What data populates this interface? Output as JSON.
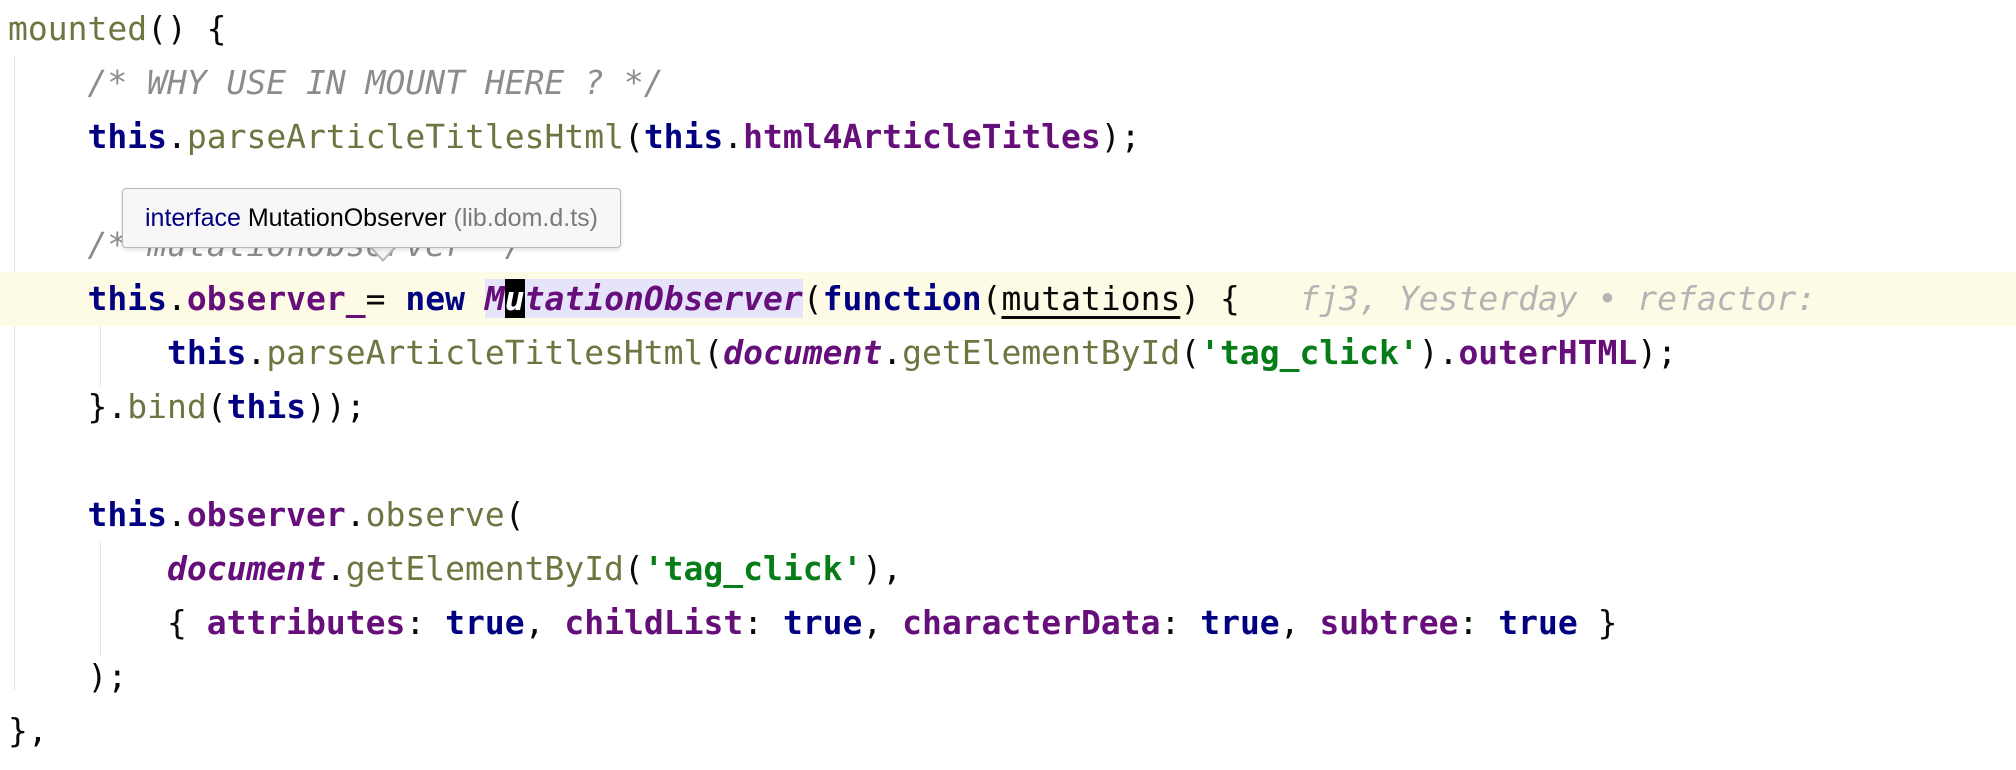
{
  "editor": {
    "lines": [
      {
        "tokens": [
          {
            "t": "mounted",
            "c": "fn"
          },
          {
            "t": "() {",
            "c": ""
          }
        ]
      },
      {
        "tokens": [
          {
            "t": "    ",
            "c": ""
          },
          {
            "t": "/* WHY USE IN MOUNT HERE ? */",
            "c": "cmt"
          }
        ]
      },
      {
        "tokens": [
          {
            "t": "    ",
            "c": ""
          },
          {
            "t": "this",
            "c": "kw"
          },
          {
            "t": ".",
            "c": ""
          },
          {
            "t": "parseArticleTitlesHtml",
            "c": "fn"
          },
          {
            "t": "(",
            "c": ""
          },
          {
            "t": "this",
            "c": "kw"
          },
          {
            "t": ".",
            "c": ""
          },
          {
            "t": "html4ArticleTitles",
            "c": "prop"
          },
          {
            "t": ");",
            "c": ""
          }
        ]
      },
      {
        "tokens": []
      },
      {
        "tokens": [
          {
            "t": "    ",
            "c": ""
          },
          {
            "t": "/* mutationObserver */",
            "c": "cmt"
          }
        ]
      },
      {
        "tokens": [
          {
            "t": "    ",
            "c": ""
          },
          {
            "t": "this",
            "c": "kw"
          },
          {
            "t": ".",
            "c": ""
          },
          {
            "t": "observer_",
            "c": "prop"
          },
          {
            "t": "= ",
            "c": ""
          },
          {
            "t": "new",
            "c": "kw"
          },
          {
            "t": " ",
            "c": ""
          },
          {
            "t": "M",
            "c": "prop ital symbol-hl"
          },
          {
            "t": "u",
            "c": "prop ital caret-char"
          },
          {
            "t": "tationObserver",
            "c": "prop ital symbol-hl"
          },
          {
            "t": "(",
            "c": ""
          },
          {
            "t": "function",
            "c": "kw"
          },
          {
            "t": "(",
            "c": ""
          },
          {
            "t": "mutations",
            "c": "param"
          },
          {
            "t": ") {   ",
            "c": ""
          },
          {
            "t": "fj3, Yesterday • refactor: ",
            "c": "blame"
          }
        ]
      },
      {
        "tokens": [
          {
            "t": "        ",
            "c": ""
          },
          {
            "t": "this",
            "c": "kw"
          },
          {
            "t": ".",
            "c": ""
          },
          {
            "t": "parseArticleTitlesHtml",
            "c": "fn"
          },
          {
            "t": "(",
            "c": ""
          },
          {
            "t": "document",
            "c": "glob"
          },
          {
            "t": ".",
            "c": ""
          },
          {
            "t": "getElementById",
            "c": "fn"
          },
          {
            "t": "(",
            "c": ""
          },
          {
            "t": "'tag_click'",
            "c": "str"
          },
          {
            "t": ").",
            "c": ""
          },
          {
            "t": "outerHTML",
            "c": "prop"
          },
          {
            "t": ");",
            "c": ""
          }
        ]
      },
      {
        "tokens": [
          {
            "t": "    ",
            "c": ""
          },
          {
            "t": "}.",
            "c": ""
          },
          {
            "t": "bind",
            "c": "fn"
          },
          {
            "t": "(",
            "c": ""
          },
          {
            "t": "this",
            "c": "kw"
          },
          {
            "t": "));",
            "c": ""
          }
        ]
      },
      {
        "tokens": []
      },
      {
        "tokens": [
          {
            "t": "    ",
            "c": ""
          },
          {
            "t": "this",
            "c": "kw"
          },
          {
            "t": ".",
            "c": ""
          },
          {
            "t": "observer",
            "c": "prop"
          },
          {
            "t": ".",
            "c": ""
          },
          {
            "t": "observe",
            "c": "fn"
          },
          {
            "t": "(",
            "c": ""
          }
        ]
      },
      {
        "tokens": [
          {
            "t": "        ",
            "c": ""
          },
          {
            "t": "document",
            "c": "glob"
          },
          {
            "t": ".",
            "c": ""
          },
          {
            "t": "getElementById",
            "c": "fn"
          },
          {
            "t": "(",
            "c": ""
          },
          {
            "t": "'tag_click'",
            "c": "str"
          },
          {
            "t": "),",
            "c": ""
          }
        ]
      },
      {
        "tokens": [
          {
            "t": "        ",
            "c": ""
          },
          {
            "t": "{ ",
            "c": ""
          },
          {
            "t": "attributes",
            "c": "prop"
          },
          {
            "t": ": ",
            "c": ""
          },
          {
            "t": "true",
            "c": "kw"
          },
          {
            "t": ", ",
            "c": ""
          },
          {
            "t": "childList",
            "c": "prop"
          },
          {
            "t": ": ",
            "c": ""
          },
          {
            "t": "true",
            "c": "kw"
          },
          {
            "t": ", ",
            "c": ""
          },
          {
            "t": "characterData",
            "c": "prop"
          },
          {
            "t": ": ",
            "c": ""
          },
          {
            "t": "true",
            "c": "kw"
          },
          {
            "t": ", ",
            "c": ""
          },
          {
            "t": "subtree",
            "c": "prop"
          },
          {
            "t": ": ",
            "c": ""
          },
          {
            "t": "true",
            "c": "kw"
          },
          {
            "t": " }",
            "c": ""
          }
        ]
      },
      {
        "tokens": [
          {
            "t": "    ",
            "c": ""
          },
          {
            "t": ");",
            "c": ""
          }
        ]
      },
      {
        "tokens": [
          {
            "t": "},",
            "c": ""
          }
        ]
      }
    ],
    "current_line_index": 5
  },
  "tooltip": {
    "keyword": "interface",
    "name": "MutationObserver",
    "source": "(lib.dom.d.ts)"
  },
  "colors": {
    "keyword": "#000080",
    "function": "#6f7540",
    "property": "#660e7a",
    "string": "#067d17",
    "comment": "#8c8c8c",
    "current_line": "#fdfbe6",
    "symbol_highlight": "#e6e4fb"
  }
}
